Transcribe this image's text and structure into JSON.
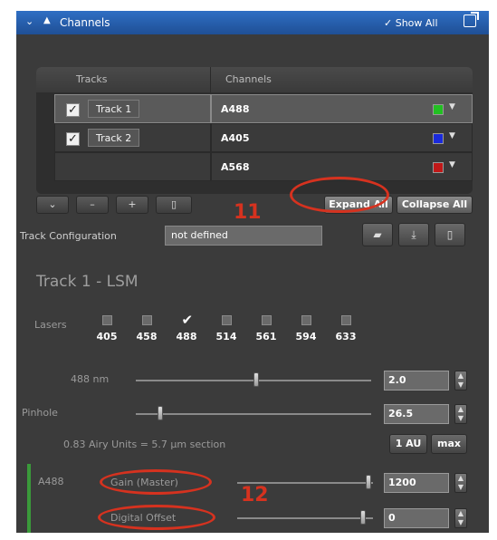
{
  "header": {
    "title": "Channels",
    "show_all": "✓ Show All"
  },
  "table": {
    "headers": {
      "tracks": "Tracks",
      "channels": "Channels"
    },
    "rows": [
      {
        "checked": true,
        "track": "Track 1",
        "channel": "A488",
        "swatch_color": "#22c022",
        "selected": true
      },
      {
        "checked": true,
        "track": "Track 2",
        "channel": "A405",
        "swatch_color": "#1a2adc",
        "selected": false
      },
      {
        "checked": false,
        "track": "",
        "channel": "A568",
        "swatch_color": "#c01818",
        "selected": false
      }
    ],
    "toolbar": {
      "expand_all": "Expand All",
      "collapse_all": "Collapse All"
    }
  },
  "annotations": {
    "a11": "11",
    "a12": "12"
  },
  "track_configuration": {
    "label": "Track Configuration",
    "value": "not defined"
  },
  "lsm": {
    "title": "Track 1 - LSM",
    "lasers_label": "Lasers",
    "lasers": [
      {
        "wl": "405",
        "on": false
      },
      {
        "wl": "458",
        "on": false
      },
      {
        "wl": "488",
        "on": true
      },
      {
        "wl": "514",
        "on": false
      },
      {
        "wl": "561",
        "on": false
      },
      {
        "wl": "594",
        "on": false
      },
      {
        "wl": "633",
        "on": false
      }
    ],
    "laser_488": {
      "label": "488 nm",
      "value": "2.0"
    },
    "pinhole": {
      "label": "Pinhole",
      "value": "26.5"
    },
    "airy_text": "0.83 Airy Units  =  5.7 μm section",
    "btn_1au": "1 AU",
    "btn_max": "max"
  },
  "channel": {
    "name": "A488",
    "gain_label": "Gain (Master)",
    "gain_value": "1200",
    "offset_label": "Digital Offset",
    "offset_value": "0"
  }
}
